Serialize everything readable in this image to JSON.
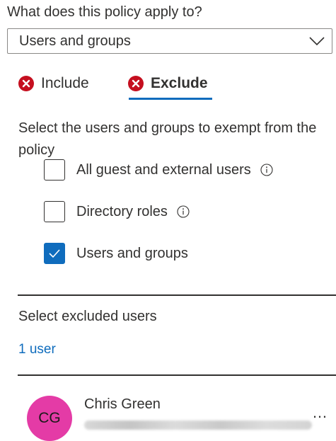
{
  "policy": {
    "question": "What does this policy apply to?",
    "applies_to_value": "Users and groups"
  },
  "tabs": [
    {
      "label": "Include",
      "icon": "error-circle-icon",
      "selected": false
    },
    {
      "label": "Exclude",
      "icon": "error-circle-icon",
      "selected": true
    }
  ],
  "exclude": {
    "instruction": "Select the users and groups to exempt from the policy",
    "options": [
      {
        "label": "All guest and external users",
        "checked": false,
        "has_info": true
      },
      {
        "label": "Directory roles",
        "checked": false,
        "has_info": true
      },
      {
        "label": "Users and groups",
        "checked": true,
        "has_info": false
      }
    ],
    "section_label": "Select excluded users",
    "count_link": "1 user",
    "user": {
      "initials": "CG",
      "name": "Chris Green",
      "more_label": "…"
    }
  },
  "colors": {
    "accent": "#0f6cbd",
    "error": "#c50f1f",
    "avatar": "#e43ba6"
  }
}
